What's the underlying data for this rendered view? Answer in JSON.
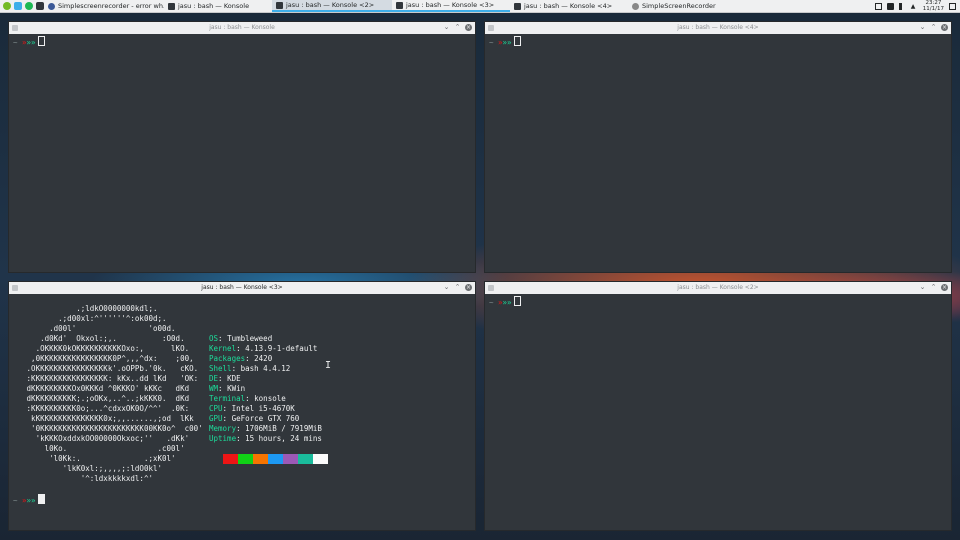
{
  "taskbar": {
    "tasks": [
      {
        "label": "Simplescreenrecorder - error wh..."
      },
      {
        "label": "jasu : bash — Konsole"
      },
      {
        "label": "jasu : bash — Konsole <2>"
      },
      {
        "label": "jasu : bash — Konsole <3>"
      },
      {
        "label": "jasu : bash — Konsole <4>"
      },
      {
        "label": "SimpleScreenRecorder"
      }
    ],
    "clock_time": "23:27",
    "clock_date": "11/1/17"
  },
  "windows": {
    "top_left": {
      "title": "jasu : bash — Konsole"
    },
    "top_right": {
      "title": "jasu : bash — Konsole <4>"
    },
    "bottom_left": {
      "title": "jasu : bash — Konsole <3>"
    },
    "bottom_right": {
      "title": "jasu : bash — Konsole <2>"
    }
  },
  "prompt": {
    "tilde": "~",
    "arrows_red": "»",
    "arrows_green": "»»"
  },
  "neofetch": {
    "logo_lines": [
      "              .;ldkO0000000kdl;.",
      "          .;d00xl:^''''''^:ok00d;.",
      "        .d00l'                'o00d.",
      "      .d0Kd'  Okxol:;,.          :O0d.",
      "     .OKKKK0kOKKKKKKKKKKOxo:,      lKO.",
      "    ,0KKKKKKKKKKKKKKKK0P^,,,^dx:    ;00,",
      "   .OKKKKKKKKKKKKKKKKk'.oOPPb.'0k.   cKO.",
      "   :KKKKKKKKKKKKKKKKK: kKx..dd lKd   'OK:",
      "   dKKKKKKKKKOx0KKKd ^0KKKO' kKKc   dKd",
      "   dKKKKKKKKKK;.;oOKx,..^..;kKKK0.  dKd",
      "   :KKKKKKKKKK0o;...^cdxxOK0O/^^'  .0K:",
      "    kKKKKKKKKKKKKKKK0x;,,......,;od  lKk",
      "    '0KKKKKKKKKKKKKKKKKKKKKKK00KK0o^  c00'",
      "     'kKKKOxddxkOO00000Okxoc;''   .dKk'",
      "       l0Ko.                    .c00l'",
      "        'l0Kk:.              .;xK0l'",
      "           'lkK0xl:;,,,,;:ldO0kl'",
      "               '^:ldxkkkkxdl:^'"
    ],
    "info": [
      {
        "key": "OS",
        "value": "Tumbleweed"
      },
      {
        "key": "Kernel",
        "value": "4.13.9-1-default"
      },
      {
        "key": "Packages",
        "value": "2420"
      },
      {
        "key": "Shell",
        "value": "bash 4.4.12"
      },
      {
        "key": "DE",
        "value": "KDE"
      },
      {
        "key": "WM",
        "value": "KWin"
      },
      {
        "key": "Terminal",
        "value": "konsole"
      },
      {
        "key": "CPU",
        "value": "Intel i5-4670K"
      },
      {
        "key": "GPU",
        "value": "GeForce GTX 760"
      },
      {
        "key": "Memory",
        "value": "1706MiB / 7919MiB"
      },
      {
        "key": "Uptime",
        "value": "15 hours, 24 mins"
      }
    ],
    "palette": [
      "#ed1515",
      "#11d116",
      "#f67400",
      "#1d99f3",
      "#9b59b6",
      "#1abc9c",
      "#fcfcfc"
    ]
  }
}
